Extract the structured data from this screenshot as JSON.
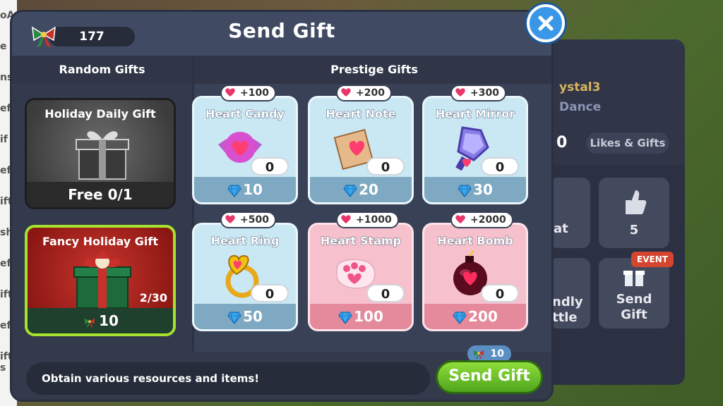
{
  "background": {
    "left_letters": [
      "oA",
      "e",
      "ns",
      "eft",
      "if",
      "eft",
      "ift",
      "sh",
      "eft",
      "ift",
      "eft",
      "ift s"
    ],
    "name_partial": "ystal3",
    "subtitle_partial": "Dance",
    "count_partial": "0",
    "likes_gifts_label": "Likes & Gifts",
    "tile_chat_partial": "at",
    "tile_likes_count": "5",
    "tile_friendly_partial_1": "ndly",
    "tile_friendly_partial_2": "ttle",
    "tile_send_gift_1": "Send",
    "tile_send_gift_2": "Gift",
    "event_badge": "EVENT"
  },
  "dialog": {
    "title": "Send Gift",
    "balance": "177",
    "tabs": {
      "random": "Random Gifts",
      "prestige": "Prestige Gifts"
    },
    "random_gifts": [
      {
        "name": "Holiday Daily Gift",
        "footer": "Free 0/1"
      },
      {
        "name": "Fancy Holiday Gift",
        "count": "2/30",
        "cost": "10"
      }
    ],
    "prestige_gifts": [
      {
        "name": "Heart Candy",
        "hearts": "+100",
        "qty": "0",
        "price": "10",
        "theme": "blue",
        "icon": "candy-icon"
      },
      {
        "name": "Heart Note",
        "hearts": "+200",
        "qty": "0",
        "price": "20",
        "theme": "blue",
        "icon": "envelope-icon"
      },
      {
        "name": "Heart Mirror",
        "hearts": "+300",
        "qty": "0",
        "price": "30",
        "theme": "blue",
        "icon": "mirror-icon"
      },
      {
        "name": "Heart Ring",
        "hearts": "+500",
        "qty": "0",
        "price": "50",
        "theme": "blue",
        "icon": "ring-icon"
      },
      {
        "name": "Heart Stamp",
        "hearts": "+1000",
        "qty": "0",
        "price": "100",
        "theme": "pink",
        "icon": "paw-stamp-icon"
      },
      {
        "name": "Heart Bomb",
        "hearts": "+2000",
        "qty": "0",
        "price": "200",
        "theme": "pink",
        "icon": "bomb-icon"
      }
    ],
    "hint": "Obtain various resources and items!",
    "send_button": "Send Gift",
    "send_cost": "10"
  },
  "colors": {
    "accent_green": "#6fc42b",
    "close_blue": "#3a97e8",
    "gem_blue": "#3aa8f0",
    "heart_pink": "#e8356a"
  }
}
